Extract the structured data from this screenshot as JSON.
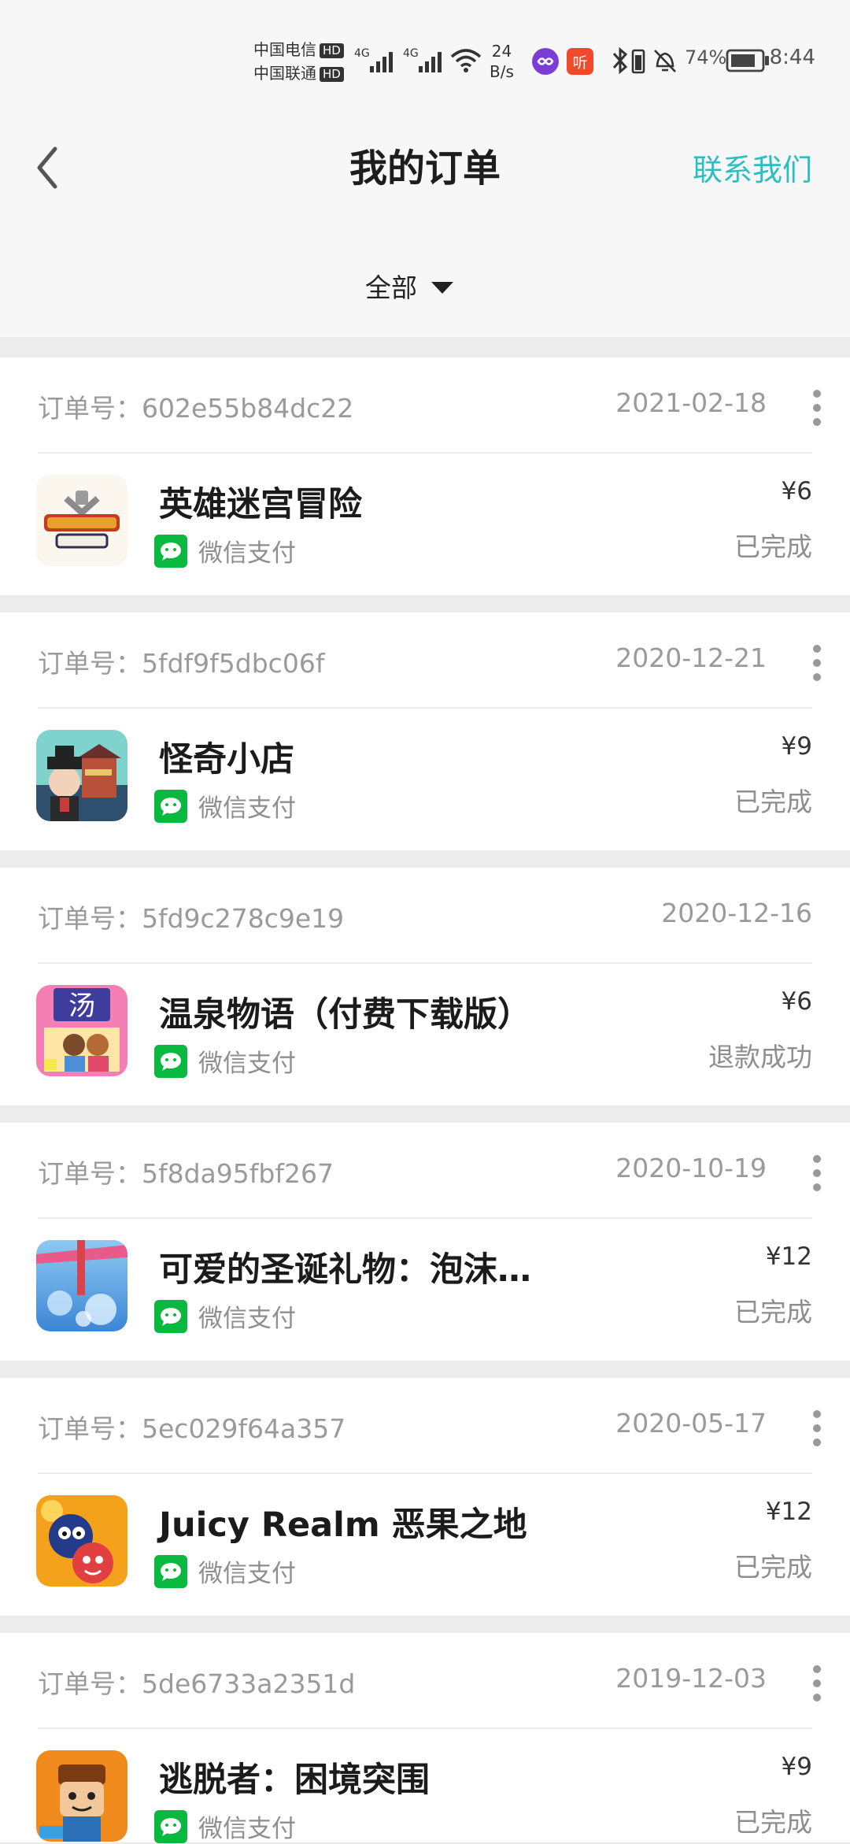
{
  "status_bar": {
    "carrier_1": "中国电信",
    "carrier_2": "中国联通",
    "hd_label": "HD",
    "network_1": "4G",
    "network_2": "4G",
    "net_speed_value": "24",
    "net_speed_unit": "B/s",
    "battery": "74%",
    "time": "8:44"
  },
  "header": {
    "back_icon": "chevron-left-icon",
    "title": "我的订单",
    "contact_label": "联系我们",
    "contact_color": "#2bbfc0"
  },
  "filter": {
    "selected": "全部"
  },
  "payment_labels": {
    "wechat": "微信支付"
  },
  "orders": [
    {
      "order_id_label": "订单号：602e55b84dc22",
      "date": "2021-02-18",
      "title": "英雄迷宫冒险",
      "price": "¥6",
      "status": "已完成",
      "has_more": true,
      "icon": "game-icon-weapon-shop-fantasy"
    },
    {
      "order_id_label": "订单号：5fdf9f5dbc06f",
      "date": "2020-12-21",
      "title": "怪奇小店",
      "price": "¥9",
      "status": "已完成",
      "has_more": true,
      "icon": "game-icon-strange-shop"
    },
    {
      "order_id_label": "订单号：5fd9c278c9e19",
      "date": "2020-12-16",
      "title": "温泉物语（付费下载版）",
      "price": "¥6",
      "status": "退款成功",
      "has_more": false,
      "icon": "game-icon-hot-spring"
    },
    {
      "order_id_label": "订单号：5f8da95fbf267",
      "date": "2020-10-19",
      "title": "可爱的圣诞礼物：泡沫…",
      "price": "¥12",
      "status": "已完成",
      "has_more": true,
      "icon": "game-icon-christmas-bubbles"
    },
    {
      "order_id_label": "订单号：5ec029f64a357",
      "date": "2020-05-17",
      "title": "Juicy Realm 恶果之地",
      "price": "¥12",
      "status": "已完成",
      "has_more": true,
      "icon": "game-icon-juicy-realm"
    },
    {
      "order_id_label": "订单号：5de6733a2351d",
      "date": "2019-12-03",
      "title": "逃脱者：困境突围",
      "price": "¥9",
      "status": "已完成",
      "has_more": true,
      "icon": "game-icon-escapists"
    }
  ]
}
